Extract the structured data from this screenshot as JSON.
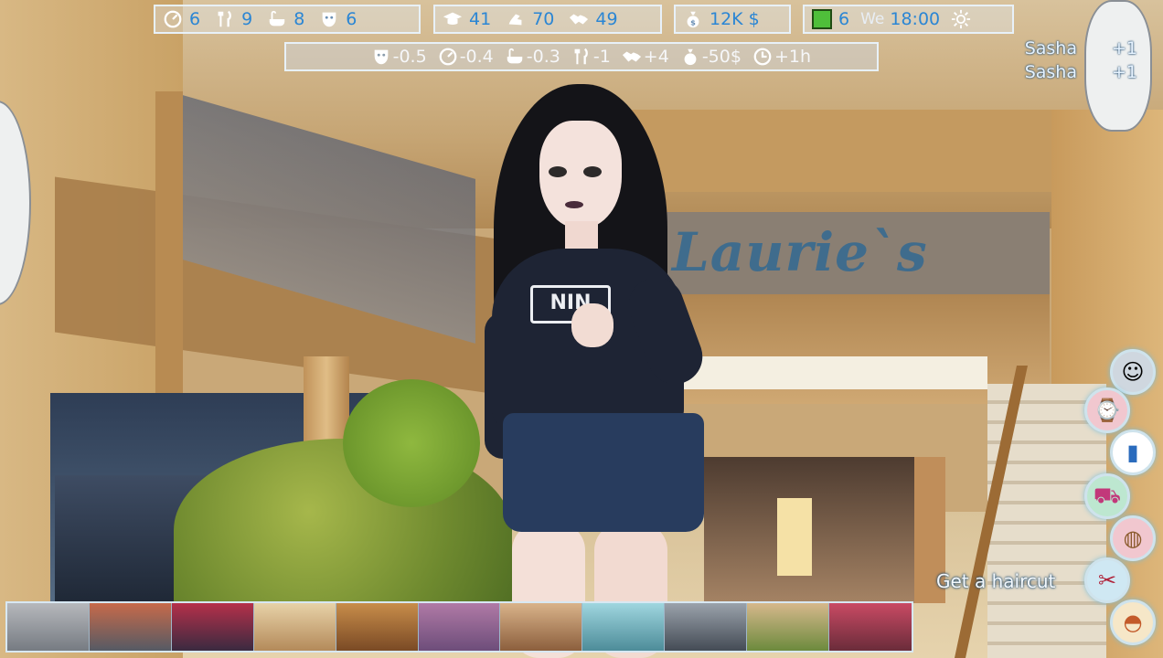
{
  "hud": {
    "box1": [
      {
        "icon": "energy-gauge-icon",
        "value": "6"
      },
      {
        "icon": "fork-knife-icon",
        "value": "9"
      },
      {
        "icon": "bathtub-icon",
        "value": "8"
      },
      {
        "icon": "mask-icon",
        "value": "6"
      }
    ],
    "box2": [
      {
        "icon": "graduation-cap-icon",
        "value": "41"
      },
      {
        "icon": "strength-icon",
        "value": "70"
      },
      {
        "icon": "handshake-icon",
        "value": "49"
      }
    ],
    "money": {
      "icon": "money-bag-icon",
      "value": "12K $"
    },
    "calendar": {
      "week": "6",
      "day": "We",
      "time": "18:00",
      "weather_icon": "sun-icon"
    }
  },
  "effects": [
    {
      "icon": "mask-icon",
      "value": "-0.5"
    },
    {
      "icon": "energy-gauge-icon",
      "value": "-0.4"
    },
    {
      "icon": "bathtub-icon",
      "value": "-0.3"
    },
    {
      "icon": "fork-knife-icon",
      "value": "-1"
    },
    {
      "icon": "handshake-icon",
      "value": "+4"
    },
    {
      "icon": "money-bag-icon",
      "value": "-50$"
    },
    {
      "icon": "clock-icon",
      "value": "+1h"
    }
  ],
  "notifications": [
    {
      "name": "Sasha",
      "value": "+1"
    },
    {
      "name": "Sasha",
      "value": "+1"
    }
  ],
  "scene": {
    "store_sign": "Laurie`s",
    "shirt_logo": "NIN"
  },
  "quick_actions": [
    {
      "icon": "portrait-icon",
      "glyph": "☺"
    },
    {
      "icon": "watch-icon",
      "glyph": "⌚"
    },
    {
      "icon": "phone-icon",
      "glyph": "▮"
    },
    {
      "icon": "shopping-bag-icon",
      "glyph": "⛟"
    },
    {
      "icon": "handbag-icon",
      "glyph": "◍"
    },
    {
      "icon": "scissors-icon",
      "glyph": "✂"
    },
    {
      "icon": "hotdog-icon",
      "glyph": "◓"
    }
  ],
  "hint": "Get a haircut",
  "locations": [
    {
      "name": "mall-entrance-thumb",
      "colors": [
        "#b6b8bc",
        "#767b82"
      ]
    },
    {
      "name": "street-thumb",
      "colors": [
        "#c76a4a",
        "#555a64"
      ]
    },
    {
      "name": "arcade-thumb",
      "colors": [
        "#b5304a",
        "#3a2a40"
      ]
    },
    {
      "name": "bakery-thumb",
      "colors": [
        "#e7d2a8",
        "#b48a5a"
      ]
    },
    {
      "name": "bookstore-thumb",
      "colors": [
        "#c88d4a",
        "#7a4a25"
      ]
    },
    {
      "name": "clothing-store-thumb",
      "colors": [
        "#b07aa6",
        "#6d4d7a"
      ]
    },
    {
      "name": "cafe-thumb",
      "colors": [
        "#d9b38a",
        "#8c5f3d"
      ]
    },
    {
      "name": "jewelry-store-thumb",
      "colors": [
        "#9fd6df",
        "#4d8c99"
      ]
    },
    {
      "name": "electronics-store-thumb",
      "colors": [
        "#9aa2ab",
        "#444b55"
      ]
    },
    {
      "name": "food-court-thumb",
      "colors": [
        "#d6b88c",
        "#6c8a3d"
      ]
    },
    {
      "name": "toy-store-thumb",
      "colors": [
        "#c94a64",
        "#6a2c3a"
      ]
    }
  ]
}
